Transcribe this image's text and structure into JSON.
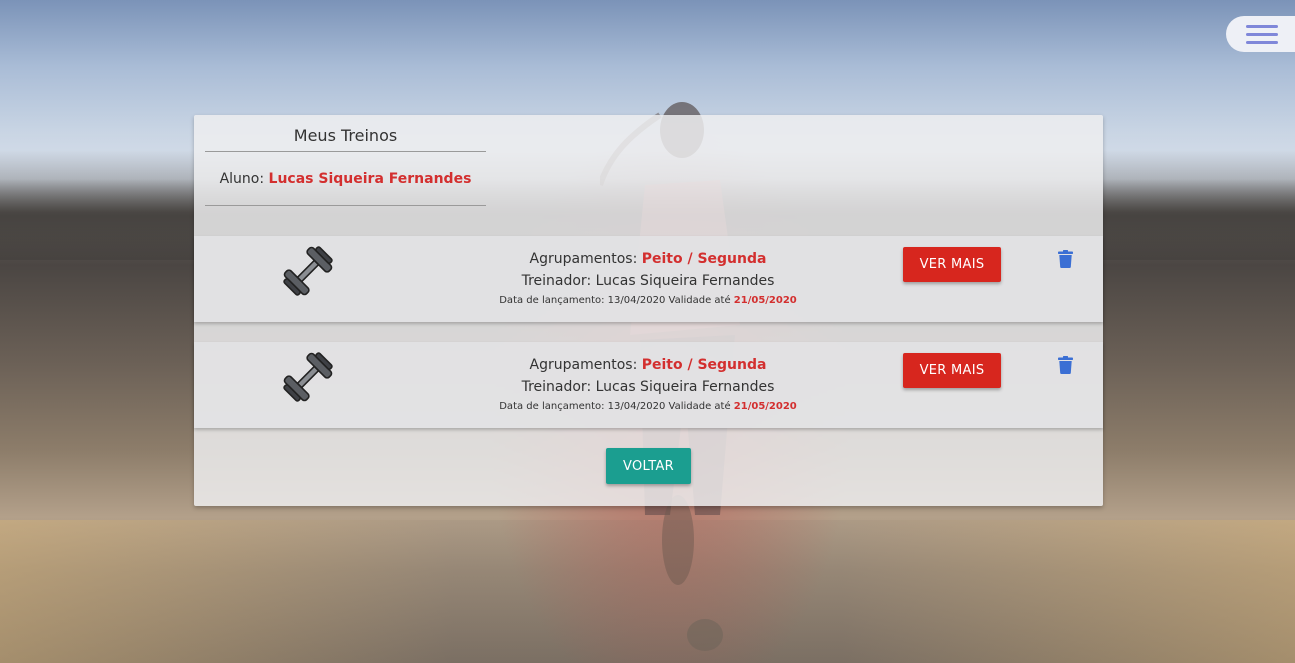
{
  "page": {
    "title": "Meus Treinos",
    "student_label": "Aluno:",
    "student_name": "Lucas Siqueira Fernandes"
  },
  "workouts": [
    {
      "grouping_label": "Agrupamentos:",
      "grouping": "Peito / Segunda",
      "trainer_label": "Treinador:",
      "trainer": "Lucas Siqueira Fernandes",
      "launch_label": "Data de lançamento:",
      "launch_date": "13/04/2020",
      "validity_label": "Validade até",
      "validity_date": "21/05/2020",
      "more_label": "VER MAIS",
      "icon": "dumbbell-icon"
    },
    {
      "grouping_label": "Agrupamentos:",
      "grouping": "Peito / Segunda",
      "trainer_label": "Treinador:",
      "trainer": "Lucas Siqueira Fernandes",
      "launch_label": "Data de lançamento:",
      "launch_date": "13/04/2020",
      "validity_label": "Validade até",
      "validity_date": "21/05/2020",
      "more_label": "VER MAIS",
      "icon": "dumbbell-icon"
    }
  ],
  "actions": {
    "back_label": "VOLTAR"
  },
  "colors": {
    "accent_red": "#d7261e",
    "highlight_red": "#d32f2f",
    "back_teal": "#1b9e90",
    "trash_blue": "#3b6fd4",
    "menu_icon": "#7f87d9"
  }
}
